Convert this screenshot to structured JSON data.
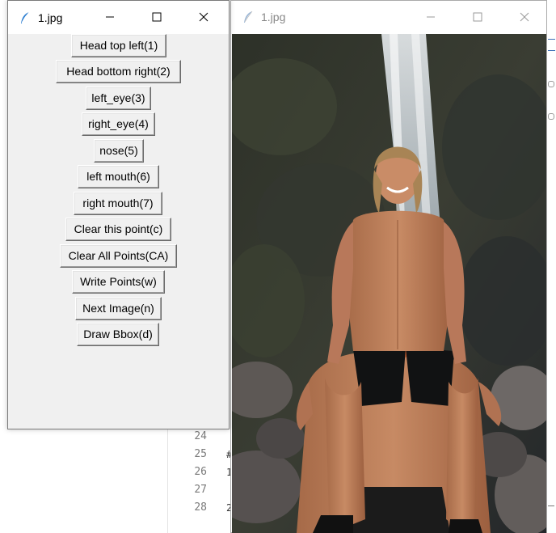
{
  "tool_window": {
    "title": "1.jpg",
    "buttons": [
      {
        "label": "Head top left(1)"
      },
      {
        "label": "Head bottom right(2)"
      },
      {
        "label": "left_eye(3)"
      },
      {
        "label": "right_eye(4)"
      },
      {
        "label": "nose(5)"
      },
      {
        "label": "left mouth(6)"
      },
      {
        "label": "right mouth(7)"
      },
      {
        "label": "Clear this point(c)"
      },
      {
        "label": "Clear All Points(CA)"
      },
      {
        "label": "Write Points(w)"
      },
      {
        "label": "Next Image(n)"
      },
      {
        "label": "Draw Bbox(d)"
      }
    ]
  },
  "image_window": {
    "title": "1.jpg"
  },
  "background_editor": {
    "line_numbers": [
      "24",
      "25",
      "26",
      "27",
      "28"
    ],
    "code_fragments": [
      "",
      "#",
      "1",
      "",
      "2"
    ]
  },
  "colors": {
    "window_bg": "#f0f0f0",
    "titlebar_bg": "#ffffff",
    "feather_icon": "#2d7fd1"
  }
}
